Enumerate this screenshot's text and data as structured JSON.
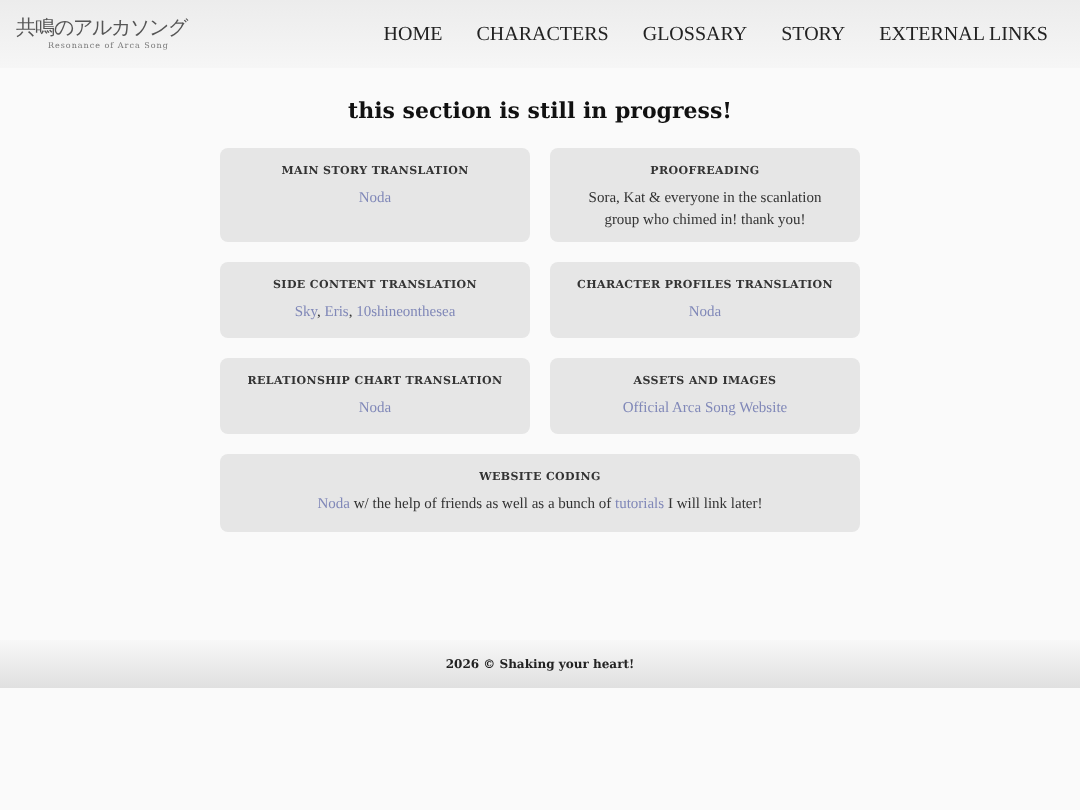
{
  "logo": {
    "title": "共鳴のアルカソング",
    "subtitle": "Resonance of Arca Song"
  },
  "nav": [
    {
      "label": "HOME"
    },
    {
      "label": "CHARACTERS"
    },
    {
      "label": "GLOSSARY"
    },
    {
      "label": "STORY"
    },
    {
      "label": "EXTERNAL LINKS"
    }
  ],
  "heading": "this section is still in progress!",
  "cards": [
    {
      "title": "MAIN STORY TRANSLATION",
      "wide": false,
      "body": [
        {
          "kind": "link",
          "text": "Noda"
        }
      ]
    },
    {
      "title": "PROOFREADING",
      "wide": false,
      "body": [
        {
          "kind": "text",
          "text": "Sora, Kat & everyone in the scanlation group who chimed in! thank you!"
        }
      ]
    },
    {
      "title": "SIDE CONTENT TRANSLATION",
      "wide": false,
      "body": [
        {
          "kind": "link",
          "text": "Sky"
        },
        {
          "kind": "text",
          "text": ", "
        },
        {
          "kind": "link",
          "text": "Eris"
        },
        {
          "kind": "text",
          "text": ", "
        },
        {
          "kind": "link",
          "text": "10shineonthesea"
        }
      ]
    },
    {
      "title": "CHARACTER PROFILES TRANSLATION",
      "wide": false,
      "body": [
        {
          "kind": "link",
          "text": "Noda"
        }
      ]
    },
    {
      "title": "RELATIONSHIP CHART TRANSLATION",
      "wide": false,
      "body": [
        {
          "kind": "link",
          "text": "Noda"
        }
      ]
    },
    {
      "title": "ASSETS AND IMAGES",
      "wide": false,
      "body": [
        {
          "kind": "link",
          "text": "Official Arca Song Website"
        }
      ]
    },
    {
      "title": "WEBSITE CODING",
      "wide": true,
      "body": [
        {
          "kind": "link",
          "text": "Noda"
        },
        {
          "kind": "text",
          "text": " w/ the help of friends as well as a bunch of "
        },
        {
          "kind": "link",
          "text": "tutorials"
        },
        {
          "kind": "text",
          "text": " I will link later!"
        }
      ]
    }
  ],
  "footer": "2026 © Shaking your heart!"
}
